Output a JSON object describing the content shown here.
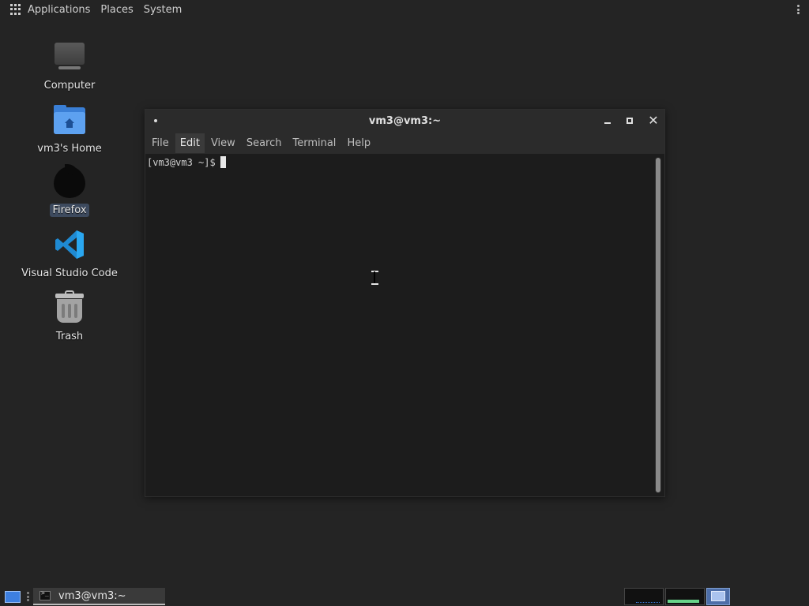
{
  "top_panel": {
    "menus": [
      "Applications",
      "Places",
      "System"
    ]
  },
  "desktop_icons": [
    {
      "label": "Computer"
    },
    {
      "label": "vm3's Home"
    },
    {
      "label": "Firefox"
    },
    {
      "label": "Visual Studio Code"
    },
    {
      "label": "Trash"
    }
  ],
  "terminal": {
    "title": "vm3@vm3:~",
    "menus": [
      "File",
      "Edit",
      "View",
      "Search",
      "Terminal",
      "Help"
    ],
    "active_menu": "Edit",
    "prompt": "[vm3@vm3 ~]$"
  },
  "taskbar": {
    "window_label": "vm3@vm3:~"
  },
  "colors": {
    "desktop_bg": "#242424",
    "selection": "#3d4a5e",
    "accent_blue": "#3d7fe0"
  }
}
